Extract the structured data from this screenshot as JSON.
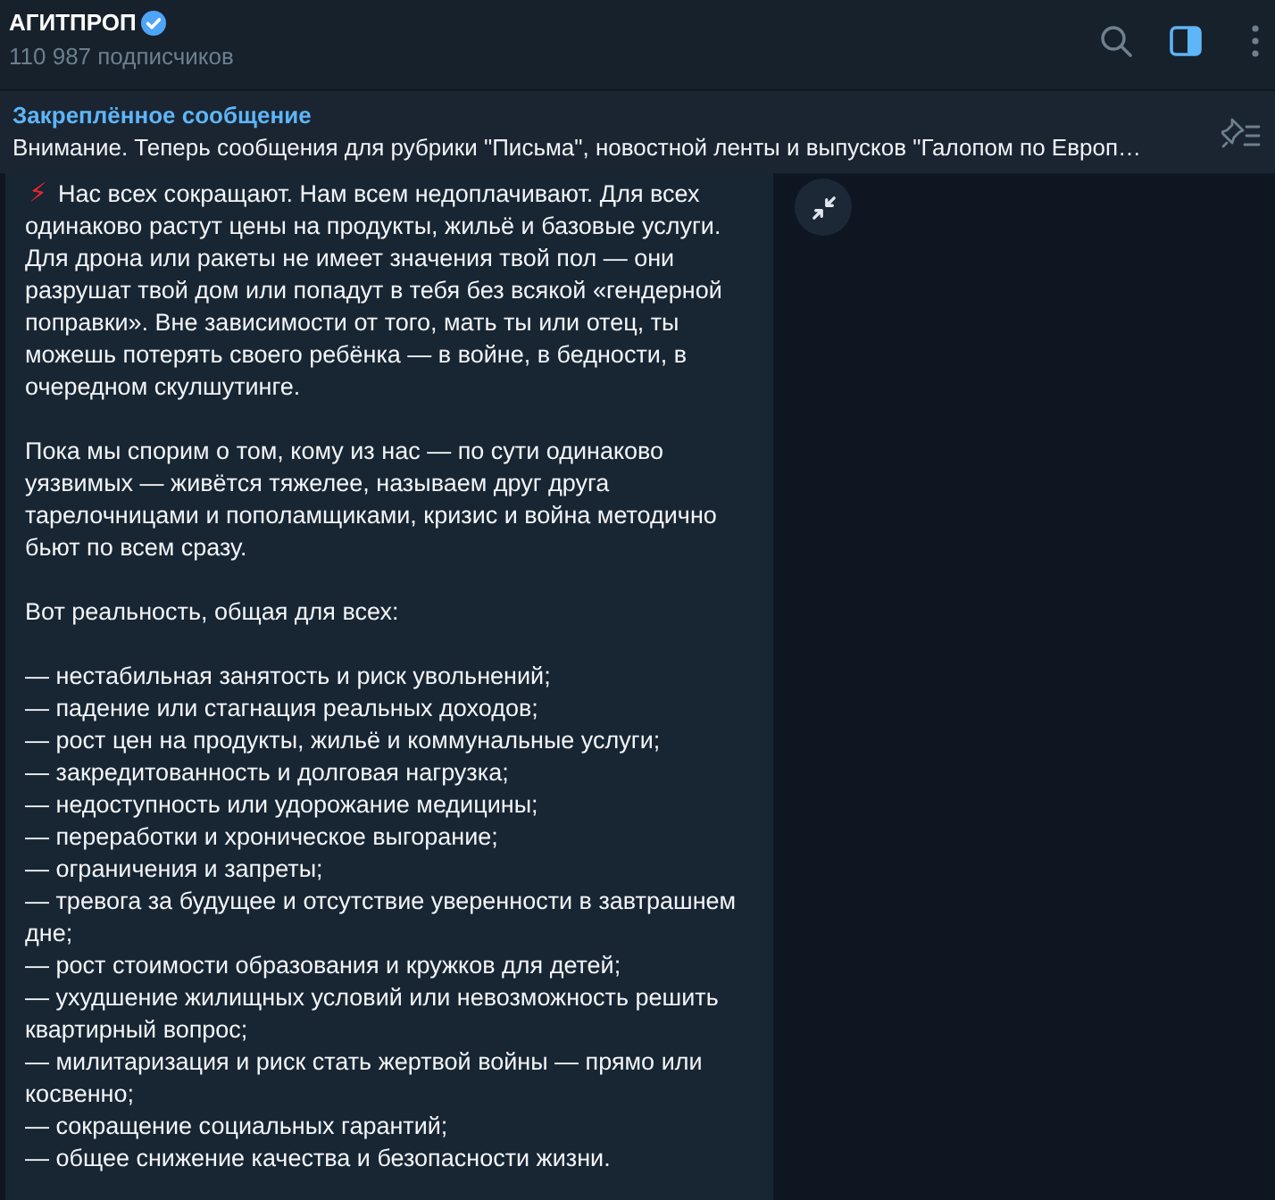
{
  "header": {
    "title": "АГИТПРОП",
    "verified": true,
    "subtitle": "110 987 подписчиков",
    "actions": [
      {
        "kind": "search",
        "active": false
      },
      {
        "kind": "sidebar",
        "active": true
      },
      {
        "kind": "more",
        "active": false
      }
    ]
  },
  "pinned": {
    "title": "Закреплённое сообщение",
    "text": "Внимание. Теперь сообщения для рубрики \"Письма\", новостной ленты и выпусков \"Галопом по Европ…"
  },
  "message": {
    "blocks": [
      {
        "kind": "lead",
        "emoji": "⚡",
        "text": "Нас всех сокращают. Нам всем недоплачивают. Для всех одинаково растут цены на продукты, жильё и базовые услуги. Для дрона или ракеты не имеет значения твой пол — они разрушат твой дом или попадут в тебя без всякой «гендерной поправки». Вне зависимости от того, мать ты или отец, ты можешь потерять своего ребёнка — в войне, в бедности, в очередном скулшутинге."
      },
      {
        "kind": "text",
        "text": "Пока мы спорим о том, кому из нас — по сути одинаково уязвимых — живётся тяжелее, называем друг друга тарелочницами и пополамщиками, кризис и война методично бьют по всем сразу."
      },
      {
        "kind": "text",
        "text": "Вот реальность, общая для всех:"
      },
      {
        "kind": "list",
        "items": [
          "— нестабильная занятость и риск увольнений;",
          "— падение или стагнация реальных доходов;",
          "— рост цен на продукты, жильё и коммунальные услуги;",
          "— закредитованность и долговая нагрузка;",
          "— недоступность или удорожание медицины;",
          "— переработки и хроническое выгорание;",
          "— ограничения и запреты;",
          "— тревога за будущее и отсутствие уверенности в завтрашнем дне;",
          "— рост стоимости образования и кружков для детей;",
          "— ухудшение жилищных условий или невозможность решить квартирный вопрос;",
          "— милитаризация и риск стать жертвой войны — прямо или косвенно;",
          "— сокращение социальных гарантий;",
          "— общее снижение качества и безопасности жизни."
        ]
      }
    ]
  }
}
